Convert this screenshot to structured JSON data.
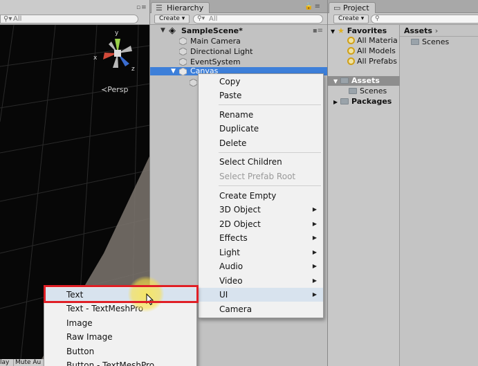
{
  "scene": {
    "search_placeholder": "All",
    "view_mode": "Persp",
    "axes": {
      "y": "y",
      "x": "x",
      "z": "z"
    },
    "bottom_tabs": [
      "lay",
      "Mute Au"
    ]
  },
  "hierarchy": {
    "tab_label": "Hierarchy",
    "create_label": "Create ▾",
    "search_placeholder": "All",
    "scene_name": "SampleScene*",
    "items": [
      {
        "label": "Main Camera"
      },
      {
        "label": "Directional Light"
      },
      {
        "label": "EventSystem"
      },
      {
        "label": "Canvas"
      }
    ]
  },
  "project": {
    "tab_label": "Project",
    "create_label": "Create ▾",
    "favorites_label": "Favorites",
    "favorites": [
      "All Materia",
      "All Models",
      "All Prefabs"
    ],
    "assets_label": "Assets",
    "assets_children": [
      "Scenes"
    ],
    "packages_label": "Packages",
    "breadcrumb": "Assets",
    "content": [
      "Scenes"
    ]
  },
  "context_menu": {
    "items": [
      {
        "label": "Copy",
        "enabled": true,
        "submenu": false
      },
      {
        "label": "Paste",
        "enabled": true,
        "submenu": false
      },
      {
        "label": "Rename",
        "enabled": true,
        "submenu": false
      },
      {
        "label": "Duplicate",
        "enabled": true,
        "submenu": false
      },
      {
        "label": "Delete",
        "enabled": true,
        "submenu": false
      },
      {
        "label": "Select Children",
        "enabled": true,
        "submenu": false
      },
      {
        "label": "Select Prefab Root",
        "enabled": false,
        "submenu": false
      },
      {
        "label": "Create Empty",
        "enabled": true,
        "submenu": false
      },
      {
        "label": "3D Object",
        "enabled": true,
        "submenu": true
      },
      {
        "label": "2D Object",
        "enabled": true,
        "submenu": true
      },
      {
        "label": "Effects",
        "enabled": true,
        "submenu": true
      },
      {
        "label": "Light",
        "enabled": true,
        "submenu": true
      },
      {
        "label": "Audio",
        "enabled": true,
        "submenu": true
      },
      {
        "label": "Video",
        "enabled": true,
        "submenu": true
      },
      {
        "label": "UI",
        "enabled": true,
        "submenu": true,
        "hovered": true
      },
      {
        "label": "Camera",
        "enabled": true,
        "submenu": false
      }
    ]
  },
  "ui_submenu": {
    "items": [
      {
        "label": "Text",
        "highlighted": true
      },
      {
        "label": "Text - TextMeshPro"
      },
      {
        "label": "Image"
      },
      {
        "label": "Raw Image"
      },
      {
        "label": "Button"
      },
      {
        "label": "Button - TextMeshPro"
      }
    ]
  },
  "colors": {
    "selection": "#3d7fd9",
    "highlight_box": "#e01f26",
    "cursor_glow": "#f5e050"
  }
}
